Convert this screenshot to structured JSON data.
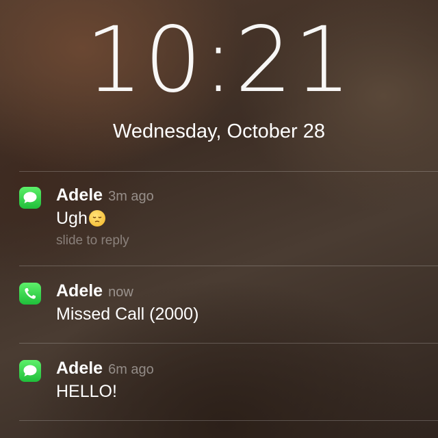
{
  "lockscreen": {
    "time": "10:21",
    "date": "Wednesday, October 28"
  },
  "notifications": [
    {
      "app": "messages",
      "icon": "messages-icon",
      "sender": "Adele",
      "age": "3m ago",
      "text": "Ugh",
      "emoji": "pensive-face-emoji",
      "hint": "slide to reply"
    },
    {
      "app": "phone",
      "icon": "phone-icon",
      "sender": "Adele",
      "age": "now",
      "text": "Missed Call (2000)"
    },
    {
      "app": "messages",
      "icon": "messages-icon",
      "sender": "Adele",
      "age": "6m ago",
      "text": "HELLO!"
    }
  ],
  "colors": {
    "app_icon_green": "#2bd14a"
  }
}
